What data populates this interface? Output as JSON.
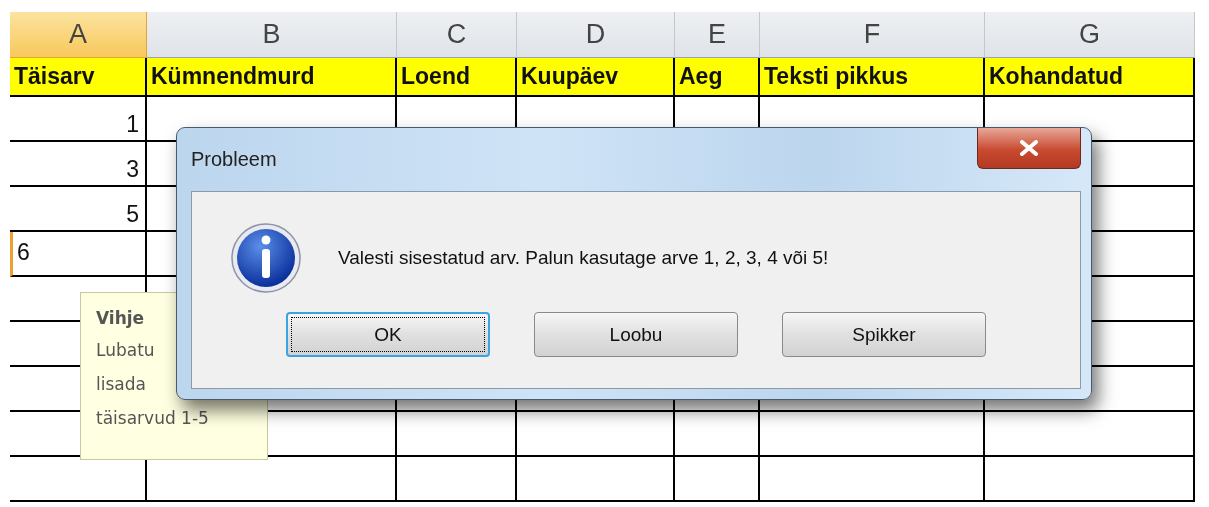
{
  "sheet": {
    "columns": [
      {
        "letter": "A",
        "header": "Täisarv",
        "selected": true
      },
      {
        "letter": "B",
        "header": "Kümnendmurd",
        "selected": false
      },
      {
        "letter": "C",
        "header": "Loend",
        "selected": false
      },
      {
        "letter": "D",
        "header": "Kuupäev",
        "selected": false
      },
      {
        "letter": "E",
        "header": "Aeg",
        "selected": false
      },
      {
        "letter": "F",
        "header": "Teksti pikkus",
        "selected": false
      },
      {
        "letter": "G",
        "header": "Kohandatud",
        "selected": false
      }
    ],
    "rows": [
      {
        "value": "1",
        "selected": false
      },
      {
        "value": "3",
        "selected": false
      },
      {
        "value": "5",
        "selected": false
      },
      {
        "value": "6",
        "selected": true
      },
      {
        "selected": false
      },
      {
        "selected": false
      },
      {
        "selected": false
      },
      {
        "selected": false
      },
      {
        "selected": false
      }
    ]
  },
  "tooltip": {
    "title": "Vihje",
    "lines": [
      "Lubatu",
      "lisada",
      "täisarvud 1-5"
    ]
  },
  "dialog": {
    "title": "Probleem",
    "message": "Valesti sisestatud arv. Palun kasutage arve 1, 2, 3, 4 või 5!",
    "buttons": [
      {
        "label": "OK",
        "default": true
      },
      {
        "label": "Loobu",
        "default": false
      },
      {
        "label": "Spikker",
        "default": false
      }
    ]
  }
}
